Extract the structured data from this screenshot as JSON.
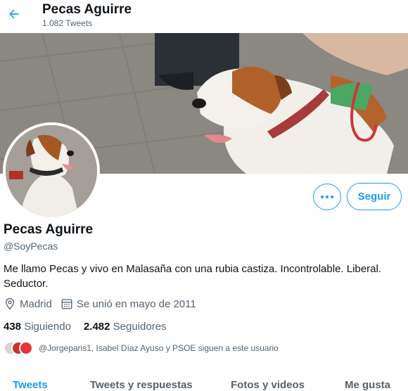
{
  "header": {
    "title": "Pecas Aguirre",
    "tweet_count": "1.082 Tweets"
  },
  "profile": {
    "name": "Pecas Aguirre",
    "handle": "@SoyPecas",
    "bio": "Me llamo Pecas y vivo en Malasaña con una rubia castiza. Incontrolable. Liberal. Seductor.",
    "location": "Madrid",
    "joined": "Se unió en mayo de 2011",
    "following_count": "438",
    "following_label": "Siguiendo",
    "followers_count": "2.482",
    "followers_label": "Seguidores",
    "followed_by_text": "@Jorgeparis1, Isabel Díaz Ayuso y PSOE siguen a este usuario"
  },
  "actions": {
    "follow_label": "Seguir",
    "more_icon": "more-dots-icon"
  },
  "tabs": [
    {
      "label": "Tweets",
      "active": true
    },
    {
      "label": "Tweets y respuestas",
      "active": false
    },
    {
      "label": "Fotos y videos",
      "active": false
    },
    {
      "label": "Me gusta",
      "active": false
    }
  ],
  "colors": {
    "accent": "#1d9bf0",
    "text_primary": "#0f1419",
    "text_secondary": "#536471"
  }
}
